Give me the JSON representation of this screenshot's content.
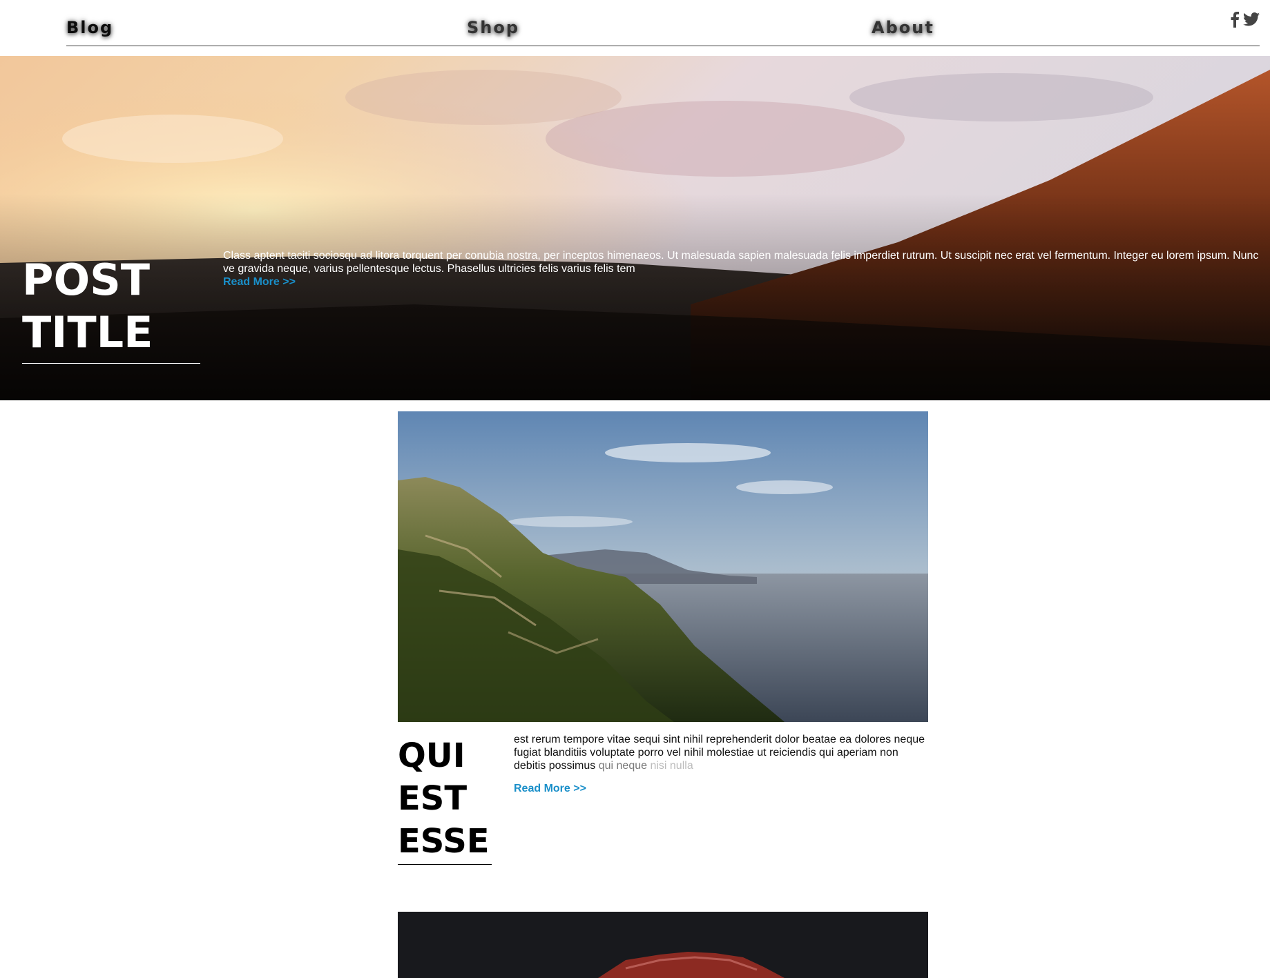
{
  "nav": {
    "blog_label": "Blog",
    "shop_label": "Shop",
    "about_label": "About",
    "social_icons": [
      "facebook-icon",
      "twitter-icon"
    ]
  },
  "hero": {
    "title": "POST TITLE",
    "excerpt": "Class aptent taciti sociosqu ad litora torquent per conubia nostra, per inceptos himenaeos. Ut malesuada sapien malesuada felis imperdiet rutrum. Ut suscipit nec erat vel fermentum. Integer eu lorem ipsum. Nunc ve gravida neque, varius pellentesque lectus. Phasellus ultricies felis varius felis tem",
    "read_more": "Read More >>"
  },
  "post": {
    "title": "QUI EST ESSE",
    "excerpt_main": "est rerum tempore vitae sequi sint nihil reprehenderit dolor beatae ea dolores neque fugiat blanditiis voluptate porro vel nihil molestiae ut reiciendis qui aperiam non debitis possimus ",
    "excerpt_fade1": "qui neque ",
    "excerpt_fade2": "nisi nulla",
    "read_more": "Read More >>"
  },
  "colors": {
    "link_accent": "#1a8fc9",
    "text_dark": "#000000",
    "hero_text": "#ffffff"
  }
}
